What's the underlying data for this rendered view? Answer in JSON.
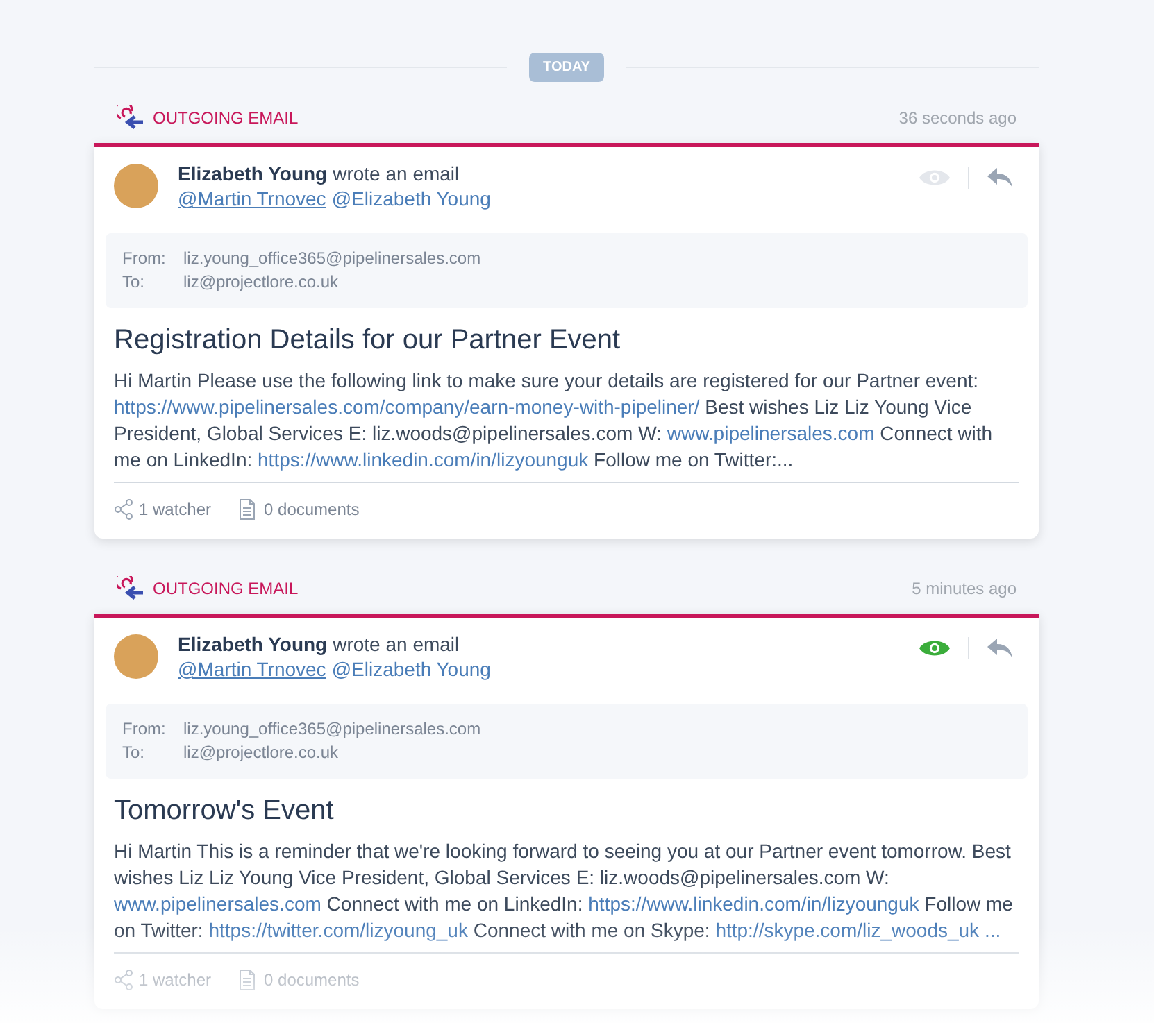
{
  "divider_label": "TODAY",
  "activities": [
    {
      "type_label": "OUTGOING EMAIL",
      "time": "36 seconds ago",
      "author": "Elizabeth Young",
      "action": "wrote an email",
      "mentions": [
        {
          "text": "@Martin Trnovec",
          "underlined": true
        },
        {
          "text": "@Elizabeth Young",
          "underlined": false
        }
      ],
      "watched": false,
      "from_label": "From:",
      "from": "liz.young_office365@pipelinersales.com",
      "to_label": "To:",
      "to": "liz@projectlore.co.uk",
      "subject": "Registration Details for our Partner Event",
      "body": [
        {
          "kind": "text",
          "text": "Hi Martin Please use the following link to make sure your details are registered for our Partner event: "
        },
        {
          "kind": "link",
          "text": "https://www.pipelinersales.com/company/earn-money-with-pipeliner/"
        },
        {
          "kind": "text",
          "text": " Best wishes Liz Liz Young Vice President, Global Services E: liz.woods@pipelinersales.com W: "
        },
        {
          "kind": "link",
          "text": "www.pipelinersales.com"
        },
        {
          "kind": "text",
          "text": " Connect with me on LinkedIn: "
        },
        {
          "kind": "link",
          "text": "https://www.linkedin.com/in/lizyounguk"
        },
        {
          "kind": "text",
          "text": " Follow me on Twitter:..."
        }
      ],
      "watchers": "1 watcher",
      "documents": "0 documents"
    },
    {
      "type_label": "OUTGOING EMAIL",
      "time": "5 minutes ago",
      "author": "Elizabeth Young",
      "action": "wrote an email",
      "mentions": [
        {
          "text": "@Martin Trnovec",
          "underlined": true
        },
        {
          "text": "@Elizabeth Young",
          "underlined": false
        }
      ],
      "watched": true,
      "from_label": "From:",
      "from": "liz.young_office365@pipelinersales.com",
      "to_label": "To:",
      "to": "liz@projectlore.co.uk",
      "subject": "Tomorrow's Event",
      "body": [
        {
          "kind": "text",
          "text": "Hi Martin This is a reminder that we're looking forward to seeing you at our Partner event tomorrow. Best wishes Liz Liz Young Vice President, Global Services E: liz.woods@pipelinersales.com W: "
        },
        {
          "kind": "link",
          "text": "www.pipelinersales.com"
        },
        {
          "kind": "text",
          "text": " Connect with me on LinkedIn: "
        },
        {
          "kind": "link",
          "text": "https://www.linkedin.com/in/lizyounguk"
        },
        {
          "kind": "text",
          "text": " Follow me on Twitter: "
        },
        {
          "kind": "link",
          "text": "https://twitter.com/lizyoung_uk"
        },
        {
          "kind": "text",
          "text": " Connect with me on Skype: "
        },
        {
          "kind": "link",
          "text": "http://skype.com/liz_woods_uk ..."
        }
      ],
      "watchers": "1 watcher",
      "documents": "0 documents"
    }
  ]
}
